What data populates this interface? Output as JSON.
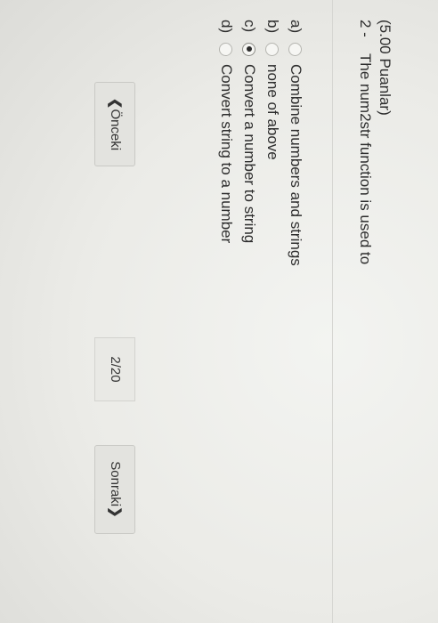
{
  "question": {
    "points": "(5.00 Puanlar)",
    "number": "2 -",
    "text": "The num2str function is used to"
  },
  "options": [
    {
      "letter": "a)",
      "label": "Combine numbers and strings",
      "selected": false
    },
    {
      "letter": "b)",
      "label": "none of above",
      "selected": false
    },
    {
      "letter": "c)",
      "label": "Convert a number to string",
      "selected": true
    },
    {
      "letter": "d)",
      "label": "Convert string to a number",
      "selected": false
    }
  ],
  "navigation": {
    "prev_label": "Önceki",
    "prev_icon": "chevron-left-icon",
    "counter": "2/20",
    "next_label": "Sonraki",
    "next_icon": "chevron-right-icon"
  }
}
